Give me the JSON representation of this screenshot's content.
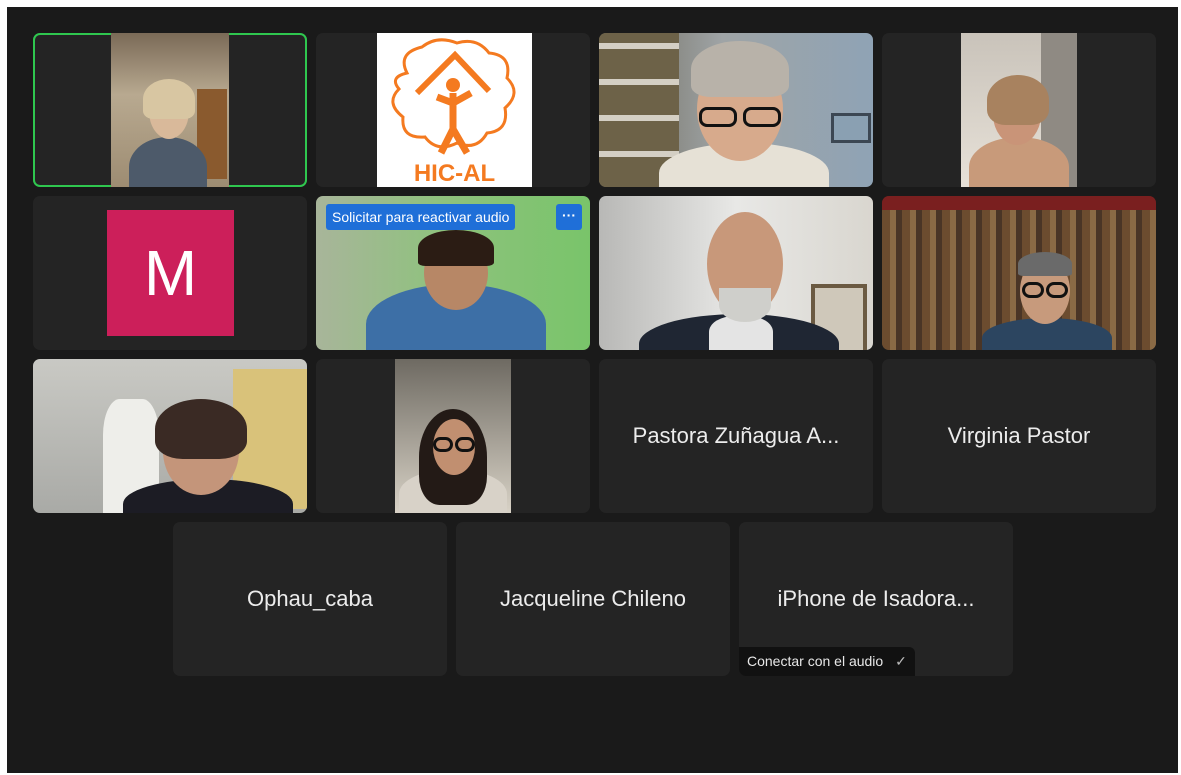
{
  "participants": [
    {
      "id": "p1",
      "kind": "video",
      "active_speaker": true
    },
    {
      "id": "p2",
      "kind": "logo",
      "logo_text": "HIC-AL"
    },
    {
      "id": "p3",
      "kind": "video"
    },
    {
      "id": "p4",
      "kind": "video"
    },
    {
      "id": "p5",
      "kind": "avatar",
      "avatar_letter": "M",
      "avatar_color": "#cc1f5a"
    },
    {
      "id": "p6",
      "kind": "video",
      "request_audio_label": "Solicitar para reactivar audio",
      "more_label": "···"
    },
    {
      "id": "p7",
      "kind": "video"
    },
    {
      "id": "p8",
      "kind": "video"
    },
    {
      "id": "p9",
      "kind": "video"
    },
    {
      "id": "p10",
      "kind": "video"
    },
    {
      "id": "p11",
      "kind": "name",
      "name": "Pastora Zuñagua A..."
    },
    {
      "id": "p12",
      "kind": "name",
      "name": "Virginia Pastor"
    },
    {
      "id": "p13",
      "kind": "name",
      "name": "Ophau_caba"
    },
    {
      "id": "p14",
      "kind": "name",
      "name": "Jacqueline Chileno"
    },
    {
      "id": "p15",
      "kind": "name",
      "name": "iPhone de Isadora...",
      "connect_audio_label": "Conectar con el audio",
      "connect_icon": "✓"
    }
  ],
  "colors": {
    "background": "#1a1a1a",
    "tile": "#242424",
    "active_border": "#2fc74f",
    "accent_blue": "#1f6fd8",
    "logo_orange": "#f47a20"
  }
}
